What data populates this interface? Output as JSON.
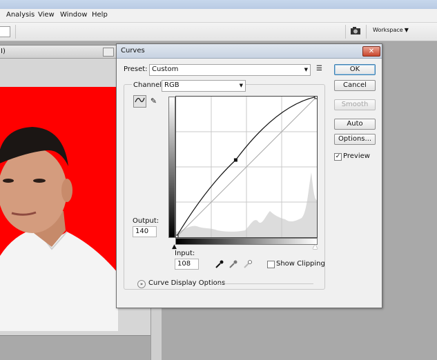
{
  "menu": [
    "Analysis",
    "View",
    "Window",
    "Help"
  ],
  "options_bar": {
    "workspace_label": "Workspace"
  },
  "document": {
    "tab_fragment": "I)"
  },
  "dialog": {
    "title": "Curves",
    "close_glyph": "✕",
    "preset": {
      "label": "Preset:",
      "value": "Custom"
    },
    "channel": {
      "label": "Channel:",
      "value": "RGB"
    },
    "buttons": {
      "ok": "OK",
      "cancel": "Cancel",
      "smooth": "Smooth",
      "auto": "Auto",
      "options": "Options..."
    },
    "preview": {
      "label": "Preview",
      "checked": true
    },
    "output": {
      "label": "Output:",
      "value": "140"
    },
    "input": {
      "label": "Input:",
      "value": "108"
    },
    "show_clipping": {
      "label": "Show Clipping",
      "checked": false
    },
    "curve_display_options": "Curve Display Options"
  },
  "curve": {
    "control_point": {
      "input": 108,
      "output": 140
    },
    "range": [
      0,
      255
    ]
  },
  "colors": {
    "photo_background": "#ff0000",
    "ok_border": "#3c7fb1"
  }
}
